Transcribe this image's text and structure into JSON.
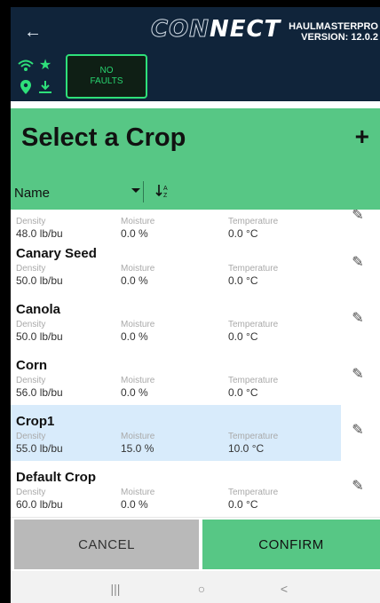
{
  "header": {
    "back_icon": "arrow-left-icon",
    "logo_text_left": "CON",
    "logo_text_right": "NECT",
    "brand": "HAULMASTERPRO",
    "version": "VERSION: 12.0.2",
    "status_icons": [
      "wifi-icon",
      "star-icon",
      "location-pin-icon",
      "download-icon"
    ],
    "faults_line1": "NO",
    "faults_line2": "FAULTS"
  },
  "page": {
    "title": "Select a Crop",
    "add_icon": "plus-icon"
  },
  "sort": {
    "field": "Name",
    "dropdown_icon": "caret-down-icon",
    "order_icon": "sort-az-icon"
  },
  "list": {
    "columns": {
      "density": "Density",
      "moisture": "Moisture",
      "temperature": "Temperature"
    },
    "partial_row": {
      "density": "48.0 lb/bu",
      "moisture": "0.0 %",
      "temperature": "0.0 °C"
    },
    "rows": [
      {
        "name": "Canary Seed",
        "density": "50.0 lb/bu",
        "moisture": "0.0 %",
        "temperature": "0.0 °C"
      },
      {
        "name": "Canola",
        "density": "50.0 lb/bu",
        "moisture": "0.0 %",
        "temperature": "0.0 °C"
      },
      {
        "name": "Corn",
        "density": "56.0 lb/bu",
        "moisture": "0.0 %",
        "temperature": "0.0 °C"
      },
      {
        "name": "Crop1",
        "density": "55.0 lb/bu",
        "moisture": "15.0 %",
        "temperature": "10.0 °C",
        "selected": true
      },
      {
        "name": "Default Crop",
        "density": "60.0 lb/bu",
        "moisture": "0.0 %",
        "temperature": "0.0 °C"
      }
    ],
    "edit_icon": "pencil-icon"
  },
  "buttons": {
    "cancel": "CANCEL",
    "confirm": "CONFIRM"
  },
  "nav": {
    "recent": "|||",
    "home": "○",
    "back": "<"
  },
  "colors": {
    "header_bg": "#10243a",
    "accent_green": "#57c785",
    "selected_row": "#d8ebfb"
  }
}
